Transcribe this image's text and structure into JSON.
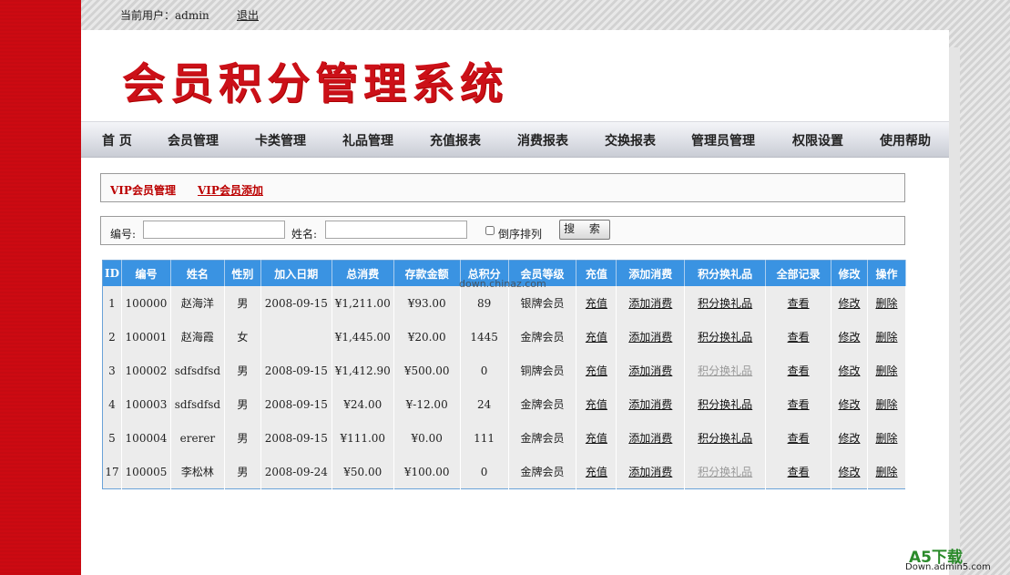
{
  "topbar": {
    "current_user": "当前用户：admin",
    "logout": "退出"
  },
  "header": {
    "title": "会员积分管理系统"
  },
  "nav": [
    "首 页",
    "会员管理",
    "卡类管理",
    "礼品管理",
    "充值报表",
    "消费报表",
    "交换报表",
    "管理员管理",
    "权限设置",
    "使用帮助"
  ],
  "tabs": [
    "VIP会员管理",
    "VIP会员添加"
  ],
  "search": {
    "id_label": "编号:",
    "name_label": "姓名:",
    "reverse_label": "倒序排列",
    "button": "搜 索"
  },
  "table": {
    "headers": [
      "ID",
      "编号",
      "姓名",
      "性别",
      "加入日期",
      "总消费",
      "存款金额",
      "总积分",
      "会员等级",
      "充值",
      "添加消费",
      "积分换礼品",
      "全部记录",
      "修改",
      "操作"
    ],
    "rows": [
      [
        "1",
        "100000",
        "赵海洋",
        "男",
        "2008-09-15",
        "¥1,211.00",
        "¥93.00",
        "89",
        "银牌会员",
        "充值",
        "添加消费",
        "积分换礼品",
        "查看",
        "修改",
        "删除"
      ],
      [
        "2",
        "100001",
        "赵海霞",
        "女",
        "",
        "¥1,445.00",
        "¥20.00",
        "1445",
        "金牌会员",
        "充值",
        "添加消费",
        "积分换礼品",
        "查看",
        "修改",
        "删除"
      ],
      [
        "3",
        "100002",
        "sdfsdfsd",
        "男",
        "2008-09-15",
        "¥1,412.90",
        "¥500.00",
        "0",
        "铜牌会员",
        "充值",
        "添加消费",
        "积分换礼品",
        "查看",
        "修改",
        "删除"
      ],
      [
        "4",
        "100003",
        "sdfsdfsd",
        "男",
        "2008-09-15",
        "¥24.00",
        "¥-12.00",
        "24",
        "金牌会员",
        "充值",
        "添加消费",
        "积分换礼品",
        "查看",
        "修改",
        "删除"
      ],
      [
        "5",
        "100004",
        "ererer",
        "男",
        "2008-09-15",
        "¥111.00",
        "¥0.00",
        "111",
        "金牌会员",
        "充值",
        "添加消费",
        "积分换礼品",
        "查看",
        "修改",
        "删除"
      ],
      [
        "17",
        "100005",
        "李松林",
        "男",
        "2008-09-24",
        "¥50.00",
        "¥100.00",
        "0",
        "金牌会员",
        "充值",
        "添加消费",
        "积分换礼品",
        "查看",
        "修改",
        "删除"
      ]
    ],
    "gift_disabled": [
      false,
      false,
      true,
      false,
      false,
      true
    ]
  },
  "watermarks": {
    "center": "down.chinaz.com",
    "logo": "A5下载",
    "logo_sub": "Down.admin5.com"
  },
  "colors": {
    "brand_red": "#cc0a12",
    "header_blue": "#3a93e2"
  }
}
